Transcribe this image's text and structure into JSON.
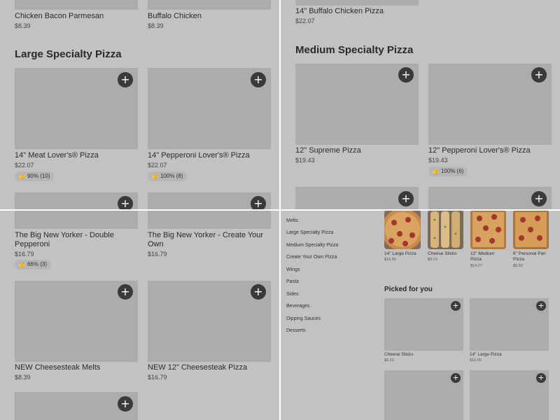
{
  "p1": {
    "top_items": [
      {
        "name": "Chicken Bacon Parmesan",
        "price": "$8.39"
      },
      {
        "name": "Buffalo Chicken",
        "price": "$8.39"
      }
    ],
    "section_title": "Large Specialty Pizza",
    "items": [
      {
        "name": "14\" Meat Lover's® Pizza",
        "price": "$22.07",
        "rating": "90% (10)"
      },
      {
        "name": "14\" Pepperoni Lover's® Pizza",
        "price": "$22.07",
        "rating": "100% (8)"
      }
    ]
  },
  "p2": {
    "top_item": {
      "name": "14\" Buffalo Chicken Pizza",
      "price": "$22.07"
    },
    "section_title": "Medium Specialty Pizza",
    "items": [
      {
        "name": "12\" Supreme Pizza",
        "price": "$19.43"
      },
      {
        "name": "12\" Pepperoni Lover's® Pizza",
        "price": "$19.43",
        "rating": "100% (6)"
      }
    ]
  },
  "p3": {
    "items": [
      {
        "name": "The Big New Yorker - Double Pepperoni",
        "price": "$16.79",
        "rating": "66% (3)"
      },
      {
        "name": "The Big New Yorker - Create Your Own",
        "price": "$16.79"
      },
      {
        "name": "NEW Cheesesteak Melts",
        "price": "$8.39"
      },
      {
        "name": "NEW 12\" Cheesesteak Pizza",
        "price": "$16.79"
      }
    ]
  },
  "p4": {
    "categories": [
      "Melts",
      "Large Specialty Pizza",
      "Medium Specialty Pizza",
      "Create Your Own Pizza",
      "Wings",
      "Pasta",
      "Sides",
      "Beverages",
      "Dipping Sauces",
      "Desserts"
    ],
    "popular": [
      {
        "name": "14\" Large Pizza",
        "price": "$16.55"
      },
      {
        "name": "Cheese Sticks",
        "price": "$9.23"
      },
      {
        "name": "12\" Medium Pizza",
        "price": "$14.27"
      },
      {
        "name": "6\" Personal Pan Pizza",
        "price": "$6.59"
      }
    ],
    "picked_title": "Picked for you",
    "picked": [
      {
        "name": "Cheese Sticks",
        "price": "$9.23"
      },
      {
        "name": "14\" Large Pizza",
        "price": "$16.55"
      }
    ]
  },
  "icons": {
    "add": "plus-icon",
    "thumb": "thumbs-up-icon"
  },
  "plus_glyph": "+",
  "thumb_glyph": "👍"
}
